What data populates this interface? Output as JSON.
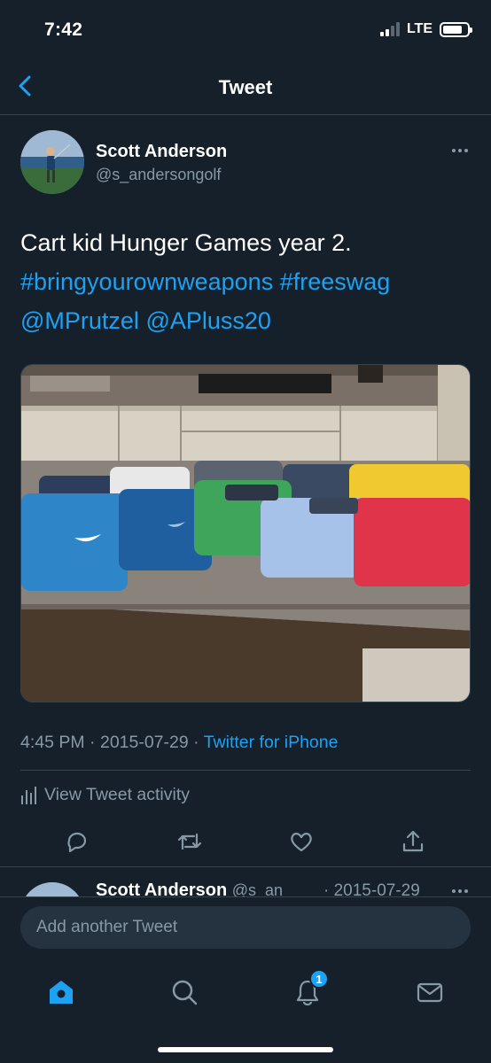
{
  "status_bar": {
    "time": "7:42",
    "network": "LTE"
  },
  "nav": {
    "title": "Tweet"
  },
  "tweet": {
    "author_name": "Scott Anderson",
    "author_handle": "@s_andersongolf",
    "text_plain": "Cart kid Hunger Games year 2.",
    "hashtag_1": "#bringyourownweapons",
    "hashtag_2": "#freeswag",
    "mention_1": "@MPrutzel",
    "mention_2": "@APluss20",
    "time": "4:45 PM",
    "date": "2015-07-29",
    "source": "Twitter for iPhone",
    "separator": "·"
  },
  "activity": {
    "label": "View Tweet activity"
  },
  "actions": [
    "reply-icon",
    "retweet-icon",
    "like-icon",
    "share-icon"
  ],
  "reply_preview": {
    "name": "Scott Anderson",
    "handle": "@s_an",
    "date": "· 2015-07-29"
  },
  "compose": {
    "placeholder": "Add another Tweet"
  },
  "tabbar": {
    "items": [
      "home-icon",
      "search-icon",
      "notifications-icon",
      "messages-icon"
    ],
    "notifications_badge": "1"
  },
  "colors": {
    "background": "#15202b",
    "accent": "#1da1f2",
    "muted": "#8899a6",
    "divider": "#38444d"
  }
}
